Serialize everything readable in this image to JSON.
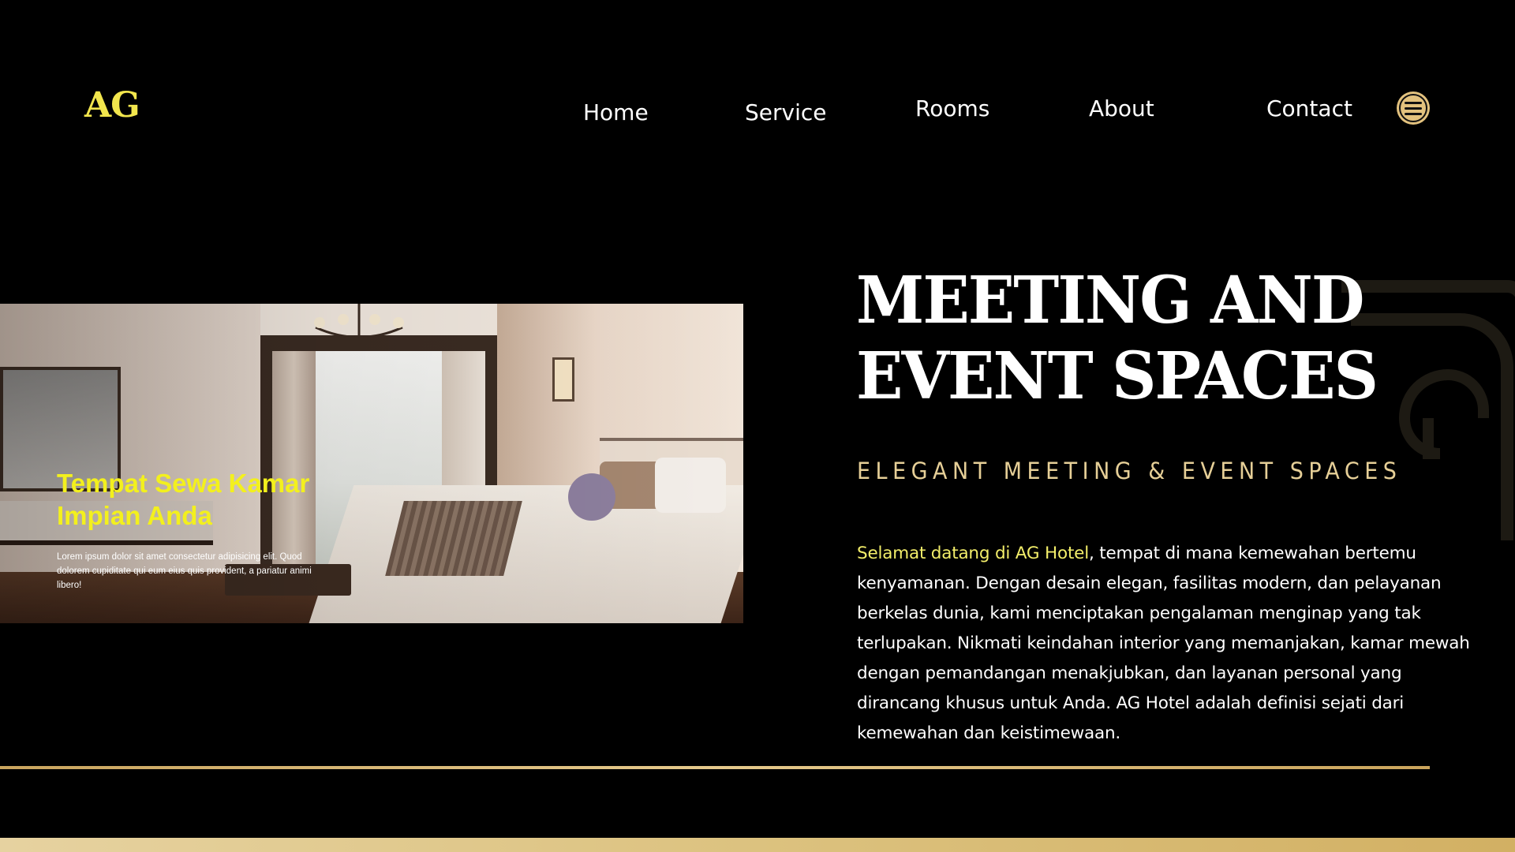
{
  "header": {
    "logo": "AG",
    "nav": [
      "Home",
      "Service",
      "Rooms",
      "About",
      "Contact"
    ],
    "menu_icon": "hamburger-menu-icon"
  },
  "hero": {
    "overlay_title": "Tempat Sewa Kamar Impian Anda",
    "overlay_body": "Lorem ipsum dolor sit amet consectetur adipisicing elit. Quod dolorem cupiditate qui eum eius quis provident, a pariatur animi libero!"
  },
  "content": {
    "headline_line1": "MEETING AND",
    "headline_line2": "EVENT SPACES",
    "subheading": "ELEGANT MEETING & EVENT SPACES",
    "paragraph_highlight": "Selamat datang di AG Hotel",
    "paragraph_rest": ", tempat di mana kemewahan bertemu kenyamanan. Dengan desain elegan, fasilitas modern, dan pelayanan berkelas dunia, kami menciptakan pengalaman menginap yang tak terlupakan. Nikmati keindahan interior yang memanjakan, kamar mewah dengan pemandangan menakjubkan, dan layanan personal yang dirancang khusus untuk Anda. AG Hotel adalah definisi sejati dari kemewahan dan keistimewaan."
  },
  "colors": {
    "background": "#000000",
    "logo_yellow": "#f2e64d",
    "gold": "#e3c27e",
    "subheading": "#e6cf97",
    "highlight": "#f3ee6a",
    "overlay_yellow": "#f3f01d"
  }
}
